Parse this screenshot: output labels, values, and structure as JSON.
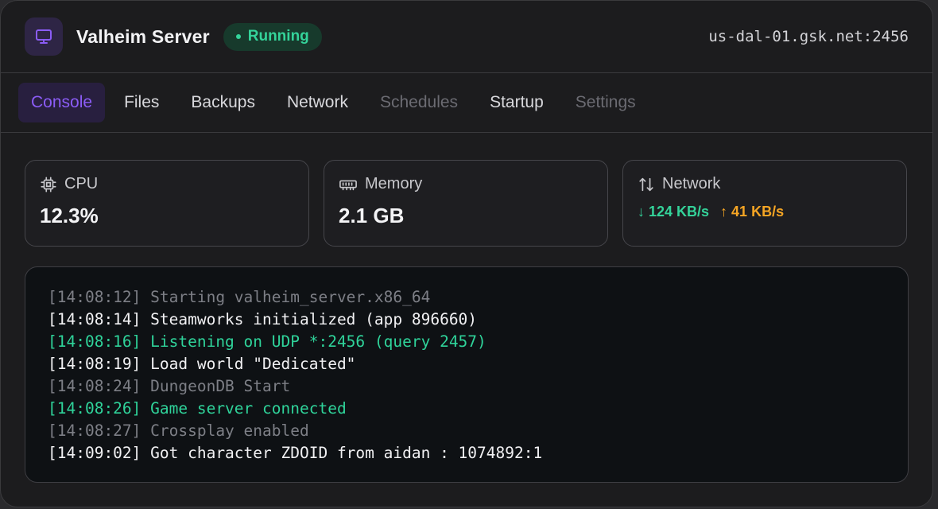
{
  "header": {
    "server_name": "Valheim Server",
    "status": "Running",
    "address": "us-dal-01.gsk.net:2456",
    "icon": "monitor-icon",
    "accent": "#8b5cf6",
    "status_color": "#34d39a"
  },
  "tabs": [
    {
      "label": "Console",
      "state": "active"
    },
    {
      "label": "Files",
      "state": "normal"
    },
    {
      "label": "Backups",
      "state": "normal"
    },
    {
      "label": "Network",
      "state": "normal"
    },
    {
      "label": "Schedules",
      "state": "disabled"
    },
    {
      "label": "Startup",
      "state": "normal"
    },
    {
      "label": "Settings",
      "state": "disabled"
    }
  ],
  "stats": {
    "cpu": {
      "label": "CPU",
      "value": "12.3%",
      "icon": "cpu-chip-icon"
    },
    "memory": {
      "label": "Memory",
      "value": "2.1 GB",
      "icon": "memory-icon"
    },
    "network": {
      "label": "Network",
      "down": "↓ 124 KB/s",
      "up": "↑ 41 KB/s",
      "icon": "arrows-up-down-icon"
    }
  },
  "console": {
    "lines": [
      {
        "text": "[14:08:12] Starting valheim_server.x86_64",
        "level": "muted"
      },
      {
        "text": "[14:08:14] Steamworks initialized (app 896660)",
        "level": "normal"
      },
      {
        "text": "[14:08:16] Listening on UDP *:2456 (query 2457)",
        "level": "success"
      },
      {
        "text": "[14:08:19] Load world \"Dedicated\"",
        "level": "normal"
      },
      {
        "text": "[14:08:24] DungeonDB Start",
        "level": "muted"
      },
      {
        "text": "[14:08:26] Game server connected",
        "level": "success"
      },
      {
        "text": "[14:08:27] Crossplay enabled",
        "level": "muted"
      },
      {
        "text": "[14:09:02] Got character ZDOID from aidan : 1074892:1",
        "level": "normal"
      }
    ]
  }
}
